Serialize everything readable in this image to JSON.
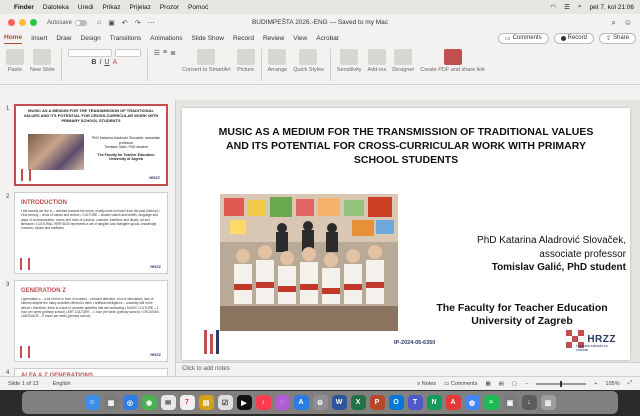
{
  "menubar": {
    "app": "Finder",
    "items": [
      "Datoteka",
      "Uredi",
      "Prikaz",
      "Prijelaz",
      "Prozor",
      "Pomoć"
    ],
    "clock": "pet 7. kol 21:06"
  },
  "titlebar": {
    "autosave_label": "Autosave",
    "document_title": "BUDIMPEŠTA 2026.-ENG — Saved to my Mac"
  },
  "ribbon": {
    "tabs": [
      "Home",
      "Insert",
      "Draw",
      "Design",
      "Transitions",
      "Animations",
      "Slide Show",
      "Record",
      "Review",
      "View",
      "Acrobat"
    ],
    "comments_label": "Comments",
    "record_label": "Record",
    "share_label": "Share",
    "groups": [
      "Paste",
      "New Slide",
      "Convert to SmartArt",
      "Picture",
      "Arrange",
      "Quick Styles",
      "Sensitivity",
      "Add-ins",
      "Designer",
      "Create PDF and share link"
    ]
  },
  "thumbnails": {
    "slide1": {
      "number": "1",
      "title": "MUSIC AS A MEDIUM FOR THE TRANSMISSION OF TRADITIONAL VALUES AND ITS POTENTIAL FOR CROSS-CURRICULAR WORK WITH PRIMARY SCHOOL STUDENTS",
      "author1": "PhD Katarina Aladrović Slovaček, associate professor",
      "author2": "Tomislav Galić, PhD student",
      "faculty": "The Faculty for Teacher Education University of Zagreb"
    },
    "slide2": {
      "number": "2",
      "heading": "INTRODUCTION",
      "body": "• the society we live in – oriented towards the future, mostly does not learn from the past (history) • 21st century – crisis of values and culture • CULTURE – shared values and beliefs, language and ways of communication, norms and rules of conduct, customs, traditions and rituals, art and literature • CULTURAL HERITAGE represents a set of tangible and intangible goods, knowledge, customs, values and traditions"
    },
    "slide3": {
      "number": "3",
      "heading": "GENERATION Z",
      "body": "• generation z – a lot of time in front of screens – reduced attention, a lot of stimulation, lack of interest despite the many activities offered to them • artificial intelligence – creativity still in the device • therefore, there is a lack of concrete activities that are motivating • MUSIC CULTURE – 1 hour per week (primary school) • ART CULTURE – 1 hour per week (primary school) • CROATIAN LANGUAGE – 5 hours per week (primary school)"
    },
    "slide4": {
      "number": "4",
      "heading": "ALFA & Z GENERATIONS"
    }
  },
  "slide": {
    "title": "MUSIC AS A MEDIUM FOR THE TRANSMISSION OF TRADITIONAL VALUES AND ITS POTENTIAL FOR CROSS-CURRICULAR WORK WITH PRIMARY SCHOOL STUDENTS",
    "author1_line1": "PhD Katarina Aladrović Slovaček,",
    "author1_line2": "associate professor",
    "author2": "Tomislav Galić, PhD student",
    "faculty_line1": "The Faculty for Teacher Education",
    "faculty_line2": "University of Zagreb",
    "code": "IP-2024-05-6350",
    "logo": "HRZZ",
    "logo_sub": "Hrvatska zaklada za znanost"
  },
  "notes_placeholder": "Click to add notes",
  "status": {
    "slide_count": "Slide 1 of 13",
    "language": "English",
    "notes": "Notes",
    "comments": "Comments",
    "zoom": "105%"
  },
  "colors": {
    "accent": "#b7472a",
    "slide_red": "#c0504d",
    "logo_blue": "#2b3a67"
  }
}
